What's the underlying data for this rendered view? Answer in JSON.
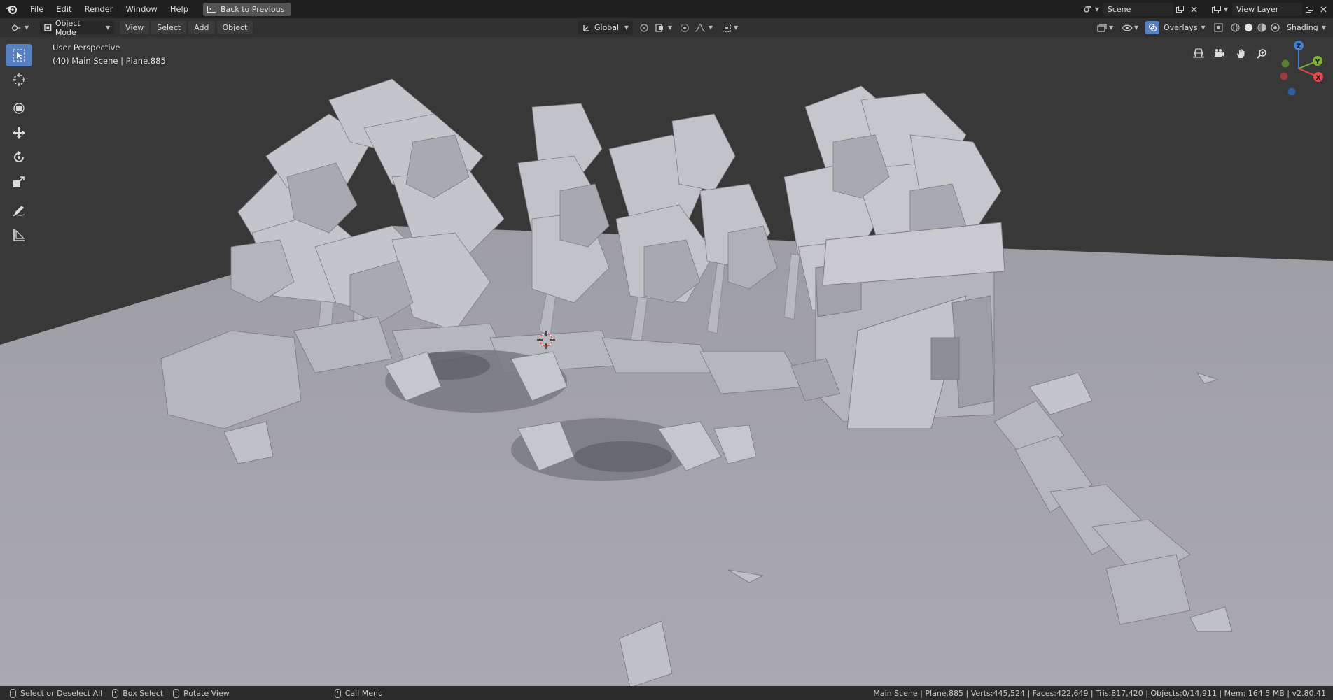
{
  "menubar": {
    "items": [
      "File",
      "Edit",
      "Render",
      "Window",
      "Help"
    ],
    "back_button": "Back to Previous",
    "scene_name": "Scene",
    "view_layer": "View Layer"
  },
  "header": {
    "mode": "Object Mode",
    "menus": [
      "View",
      "Select",
      "Add",
      "Object"
    ],
    "transform_orientation": "Global",
    "overlays_label": "Overlays",
    "shading_label": "Shading"
  },
  "viewport": {
    "perspective_label": "User Perspective",
    "object_info": "(40) Main Scene | Plane.885",
    "gizmo_axes": {
      "z": "Z",
      "y": "Y",
      "x": "X"
    }
  },
  "statusbar": {
    "select_hint": "Select or Deselect All",
    "box_select_hint": "Box Select",
    "rotate_hint": "Rotate View",
    "call_menu_hint": "Call Menu",
    "stats": "Main Scene | Plane.885 | Verts:445,524 | Faces:422,649 | Tris:817,420 | Objects:0/14,911 | Mem: 164.5 MB | v2.80.41"
  },
  "colors": {
    "background_grey": "#383838",
    "ground": "#a5a5ab",
    "active_tool": "#5680c2",
    "axis_x": "#e5484d",
    "axis_y": "#7bb23a",
    "axis_z": "#3f7fd6"
  },
  "tools": [
    "select-box",
    "cursor",
    "move-all",
    "move",
    "rotate",
    "scale",
    "annotate",
    "measure"
  ]
}
